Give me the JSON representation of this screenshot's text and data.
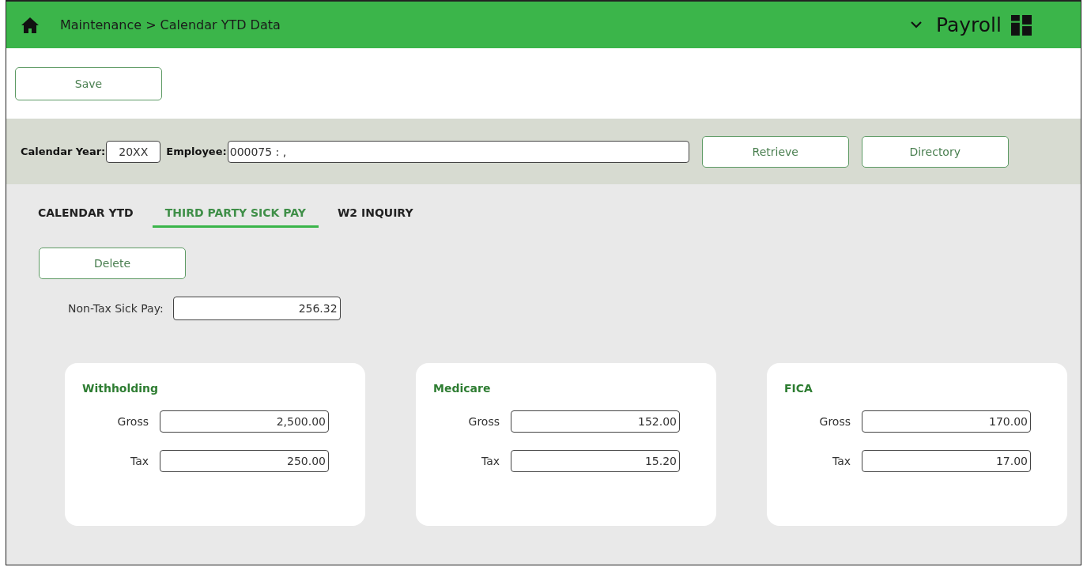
{
  "header": {
    "breadcrumb": "Maintenance > Calendar YTD Data",
    "app_name": "Payroll"
  },
  "toolbar": {
    "buttons": [
      "Save"
    ]
  },
  "search": {
    "year_label": "Calendar Year:",
    "year_value": "20XX",
    "employee_label": "Employee:",
    "employee_value": "000075 : ,",
    "buttons": [
      "Retrieve",
      "Directory"
    ]
  },
  "tabs": [
    {
      "label": "CALENDAR YTD",
      "selected": false
    },
    {
      "label": "THIRD PARTY SICK PAY",
      "selected": true
    },
    {
      "label": "W2 INQUIRY",
      "selected": false
    }
  ],
  "delete_button": "Delete",
  "non_tax": {
    "label": "Non-Tax Sick Pay:",
    "value": "256.32"
  },
  "panels": [
    {
      "title": "Withholding",
      "fields": [
        {
          "label": "Gross",
          "value": "2,500.00"
        },
        {
          "label": "Tax",
          "value": "250.00"
        }
      ]
    },
    {
      "title": "Medicare",
      "fields": [
        {
          "label": "Gross",
          "value": "152.00"
        },
        {
          "label": "Tax",
          "value": "15.20"
        }
      ]
    },
    {
      "title": "FICA",
      "fields": [
        {
          "label": "Gross",
          "value": "170.00"
        },
        {
          "label": "Tax",
          "value": "17.00"
        }
      ]
    }
  ]
}
